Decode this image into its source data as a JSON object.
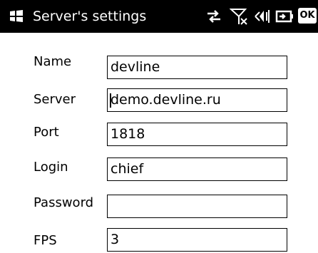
{
  "titlebar": {
    "title": "Server's settings",
    "ok_label": "OK",
    "background": "#000000",
    "text_color": "#ffffff",
    "icons": [
      "windows-start-icon",
      "connectivity-arrows-icon",
      "no-signal-icon",
      "speaker-muted-icon",
      "battery-plug-icon",
      "ok-button"
    ]
  },
  "form": {
    "fields": [
      {
        "label": "Name",
        "value": "devline"
      },
      {
        "label": "Server",
        "value": "demo.devline.ru"
      },
      {
        "label": "Port",
        "value": "1818"
      },
      {
        "label": "Login",
        "value": "chief"
      },
      {
        "label": "Password",
        "value": ""
      },
      {
        "label": "FPS",
        "value": "3"
      }
    ]
  }
}
